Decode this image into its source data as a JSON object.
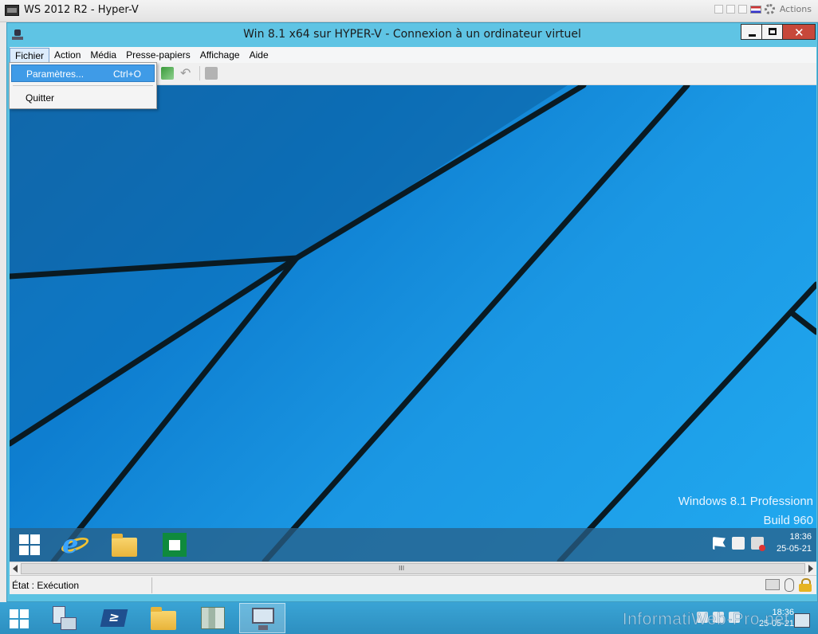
{
  "host_window": {
    "title": "WS 2012 R2 - Hyper-V",
    "actions_label": "Actions"
  },
  "vm_window": {
    "title": "Win 8.1 x64 sur HYPER-V - Connexion à un ordinateur virtuel",
    "close_glyph": "✕"
  },
  "menu": {
    "items": [
      "Fichier",
      "Action",
      "Média",
      "Presse-papiers",
      "Affichage",
      "Aide"
    ],
    "active": "Fichier"
  },
  "file_menu": {
    "items": [
      {
        "label": "Paramètres...",
        "shortcut": "Ctrl+O",
        "highlighted": true
      },
      {
        "label": "Quitter",
        "shortcut": "",
        "highlighted": false
      }
    ]
  },
  "guest_desktop": {
    "edition_text": "Windows 8.1 Professionn",
    "build_text": "Build 960",
    "clock_time": "18:36",
    "clock_date": "25-05-21",
    "taskbar_icons": [
      "start-icon",
      "ie-icon",
      "folder-icon",
      "store-icon"
    ],
    "tray_icons": [
      "flag-icon",
      "network-icon",
      "speaker-muted-icon"
    ]
  },
  "scrollbar": {
    "grip": "III"
  },
  "status": {
    "state_text": "État : Exécution",
    "icons": [
      "keyboard-icon",
      "mouse-icon",
      "lock-icon"
    ]
  },
  "host_taskbar": {
    "buttons": [
      "start-button",
      "server-manager-icon",
      "powershell-icon",
      "file-explorer-icon",
      "hyper-v-manager-icon",
      "vm-connect-icon"
    ],
    "active_button": "vm-connect-icon",
    "powershell_glyph": "≥",
    "clock_time": "18:36",
    "clock_date": "25-05-21"
  },
  "watermark": "InformatiWeb-Pro.net",
  "colors": {
    "vm_frame": "#5bc2e2",
    "desktop_blue": "#1b98e4",
    "menu_highlight": "#3f9be7",
    "host_taskbar": "#3aa4d5",
    "close_button": "#c7483a"
  }
}
